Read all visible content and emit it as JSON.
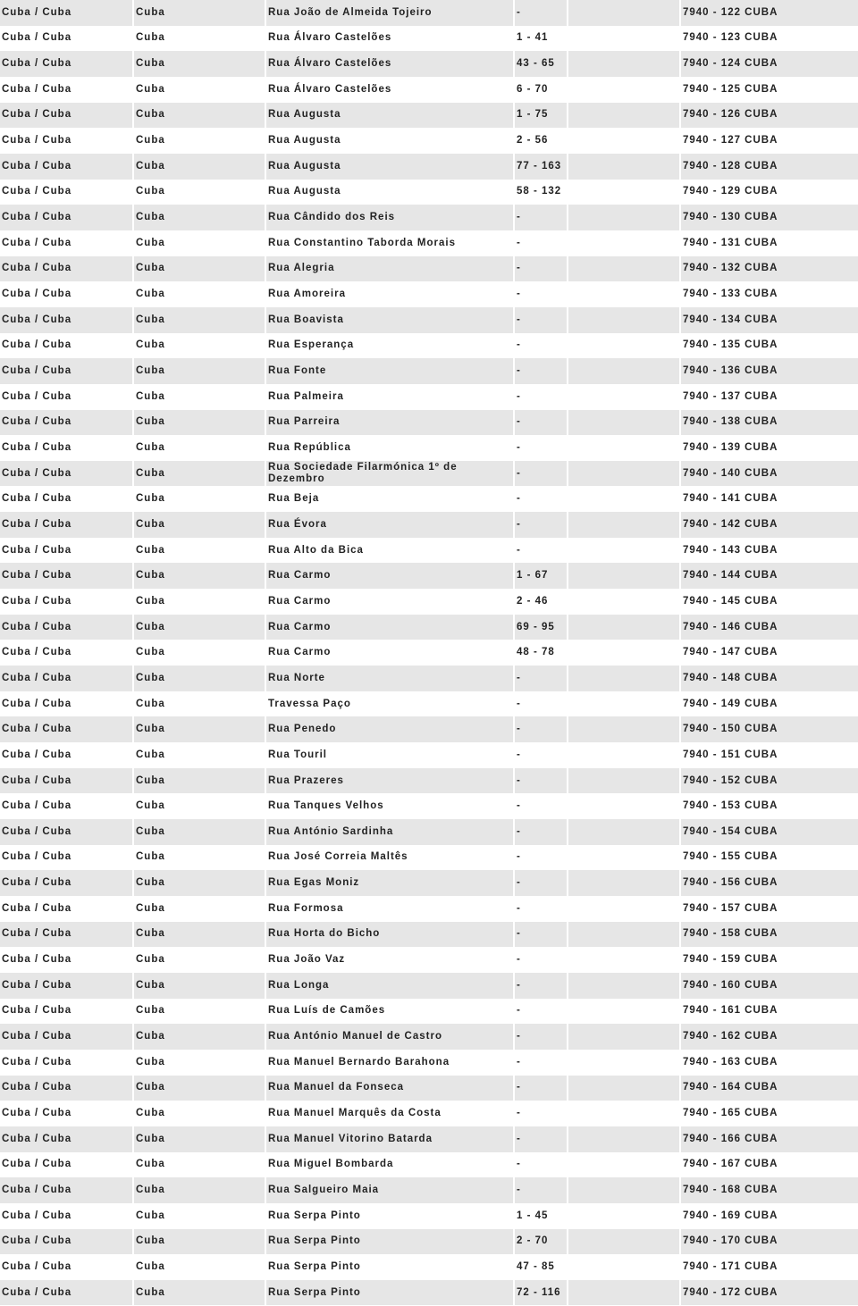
{
  "rows": [
    [
      "Cuba / Cuba",
      "Cuba",
      "Rua João de Almeida Tojeiro",
      "-",
      "7940 - 122 CUBA"
    ],
    [
      "Cuba / Cuba",
      "Cuba",
      "Rua Álvaro Castelões",
      "1 - 41",
      "7940 - 123 CUBA"
    ],
    [
      "Cuba / Cuba",
      "Cuba",
      "Rua Álvaro Castelões",
      "43 - 65",
      "7940 - 124 CUBA"
    ],
    [
      "Cuba / Cuba",
      "Cuba",
      "Rua Álvaro Castelões",
      "6 - 70",
      "7940 - 125 CUBA"
    ],
    [
      "Cuba / Cuba",
      "Cuba",
      "Rua Augusta",
      "1 - 75",
      "7940 - 126 CUBA"
    ],
    [
      "Cuba / Cuba",
      "Cuba",
      "Rua Augusta",
      "2 - 56",
      "7940 - 127 CUBA"
    ],
    [
      "Cuba / Cuba",
      "Cuba",
      "Rua Augusta",
      "77 - 163",
      "7940 - 128 CUBA"
    ],
    [
      "Cuba / Cuba",
      "Cuba",
      "Rua Augusta",
      "58 - 132",
      "7940 - 129 CUBA"
    ],
    [
      "Cuba / Cuba",
      "Cuba",
      "Rua Cândido dos Reis",
      "-",
      "7940 - 130 CUBA"
    ],
    [
      "Cuba / Cuba",
      "Cuba",
      "Rua Constantino Taborda Morais",
      "-",
      "7940 - 131 CUBA"
    ],
    [
      "Cuba / Cuba",
      "Cuba",
      "Rua Alegria",
      "-",
      "7940 - 132 CUBA"
    ],
    [
      "Cuba / Cuba",
      "Cuba",
      "Rua Amoreira",
      "-",
      "7940 - 133 CUBA"
    ],
    [
      "Cuba / Cuba",
      "Cuba",
      "Rua Boavista",
      "-",
      "7940 - 134 CUBA"
    ],
    [
      "Cuba / Cuba",
      "Cuba",
      "Rua Esperança",
      "-",
      "7940 - 135 CUBA"
    ],
    [
      "Cuba / Cuba",
      "Cuba",
      "Rua Fonte",
      "-",
      "7940 - 136 CUBA"
    ],
    [
      "Cuba / Cuba",
      "Cuba",
      "Rua Palmeira",
      "-",
      "7940 - 137 CUBA"
    ],
    [
      "Cuba / Cuba",
      "Cuba",
      "Rua Parreira",
      "-",
      "7940 - 138 CUBA"
    ],
    [
      "Cuba / Cuba",
      "Cuba",
      "Rua República",
      "-",
      "7940 - 139 CUBA"
    ],
    [
      "Cuba / Cuba",
      "Cuba",
      "Rua Sociedade Filarmónica 1º de Dezembro",
      "-",
      "7940 - 140 CUBA"
    ],
    [
      "Cuba / Cuba",
      "Cuba",
      "Rua Beja",
      "-",
      "7940 - 141 CUBA"
    ],
    [
      "Cuba / Cuba",
      "Cuba",
      "Rua Évora",
      "-",
      "7940 - 142 CUBA"
    ],
    [
      "Cuba / Cuba",
      "Cuba",
      "Rua Alto da Bica",
      "-",
      "7940 - 143 CUBA"
    ],
    [
      "Cuba / Cuba",
      "Cuba",
      "Rua Carmo",
      "1 - 67",
      "7940 - 144 CUBA"
    ],
    [
      "Cuba / Cuba",
      "Cuba",
      "Rua Carmo",
      "2 - 46",
      "7940 - 145 CUBA"
    ],
    [
      "Cuba / Cuba",
      "Cuba",
      "Rua Carmo",
      "69 - 95",
      "7940 - 146 CUBA"
    ],
    [
      "Cuba / Cuba",
      "Cuba",
      "Rua Carmo",
      "48 - 78",
      "7940 - 147 CUBA"
    ],
    [
      "Cuba / Cuba",
      "Cuba",
      "Rua Norte",
      "-",
      "7940 - 148 CUBA"
    ],
    [
      "Cuba / Cuba",
      "Cuba",
      "Travessa Paço",
      "-",
      "7940 - 149 CUBA"
    ],
    [
      "Cuba / Cuba",
      "Cuba",
      "Rua Penedo",
      "-",
      "7940 - 150 CUBA"
    ],
    [
      "Cuba / Cuba",
      "Cuba",
      "Rua Touril",
      "-",
      "7940 - 151 CUBA"
    ],
    [
      "Cuba / Cuba",
      "Cuba",
      "Rua Prazeres",
      "-",
      "7940 - 152 CUBA"
    ],
    [
      "Cuba / Cuba",
      "Cuba",
      "Rua Tanques Velhos",
      "-",
      "7940 - 153 CUBA"
    ],
    [
      "Cuba / Cuba",
      "Cuba",
      "Rua António Sardinha",
      "-",
      "7940 - 154 CUBA"
    ],
    [
      "Cuba / Cuba",
      "Cuba",
      "Rua José Correia Maltês",
      "-",
      "7940 - 155 CUBA"
    ],
    [
      "Cuba / Cuba",
      "Cuba",
      "Rua Egas Moniz",
      "-",
      "7940 - 156 CUBA"
    ],
    [
      "Cuba / Cuba",
      "Cuba",
      "Rua Formosa",
      "-",
      "7940 - 157 CUBA"
    ],
    [
      "Cuba / Cuba",
      "Cuba",
      "Rua Horta do Bicho",
      "-",
      "7940 - 158 CUBA"
    ],
    [
      "Cuba / Cuba",
      "Cuba",
      "Rua João Vaz",
      "-",
      "7940 - 159 CUBA"
    ],
    [
      "Cuba / Cuba",
      "Cuba",
      "Rua Longa",
      "-",
      "7940 - 160 CUBA"
    ],
    [
      "Cuba / Cuba",
      "Cuba",
      "Rua Luís de Camões",
      "-",
      "7940 - 161 CUBA"
    ],
    [
      "Cuba / Cuba",
      "Cuba",
      "Rua António Manuel de Castro",
      "-",
      "7940 - 162 CUBA"
    ],
    [
      "Cuba / Cuba",
      "Cuba",
      "Rua Manuel Bernardo Barahona",
      "-",
      "7940 - 163 CUBA"
    ],
    [
      "Cuba / Cuba",
      "Cuba",
      "Rua Manuel da Fonseca",
      "-",
      "7940 - 164 CUBA"
    ],
    [
      "Cuba / Cuba",
      "Cuba",
      "Rua Manuel Marquês da Costa",
      "-",
      "7940 - 165 CUBA"
    ],
    [
      "Cuba / Cuba",
      "Cuba",
      "Rua Manuel Vitorino Batarda",
      "-",
      "7940 - 166 CUBA"
    ],
    [
      "Cuba / Cuba",
      "Cuba",
      "Rua Miguel Bombarda",
      "-",
      "7940 - 167 CUBA"
    ],
    [
      "Cuba / Cuba",
      "Cuba",
      "Rua Salgueiro Maia",
      "-",
      "7940 - 168 CUBA"
    ],
    [
      "Cuba / Cuba",
      "Cuba",
      "Rua Serpa Pinto",
      "1 - 45",
      "7940 - 169 CUBA"
    ],
    [
      "Cuba / Cuba",
      "Cuba",
      "Rua Serpa Pinto",
      "2 - 70",
      "7940 - 170 CUBA"
    ],
    [
      "Cuba / Cuba",
      "Cuba",
      "Rua Serpa Pinto",
      "47 - 85",
      "7940 - 171 CUBA"
    ],
    [
      "Cuba / Cuba",
      "Cuba",
      "Rua Serpa Pinto",
      "72 - 116",
      "7940 - 172 CUBA"
    ]
  ]
}
